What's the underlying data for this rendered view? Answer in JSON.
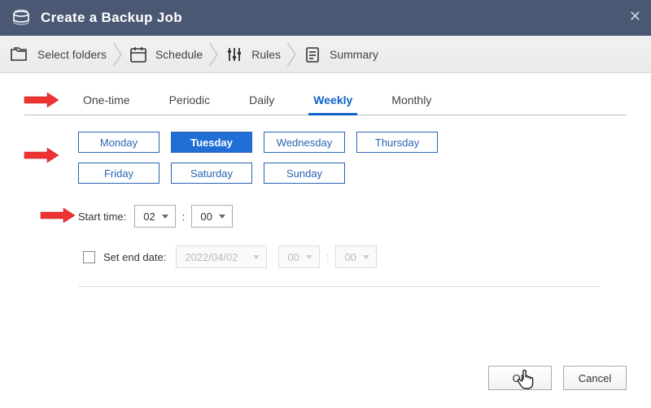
{
  "title": "Create a Backup Job",
  "steps": {
    "select_folders": "Select folders",
    "schedule": "Schedule",
    "rules": "Rules",
    "summary": "Summary"
  },
  "tabs": {
    "one_time": "One-time",
    "periodic": "Periodic",
    "daily": "Daily",
    "weekly": "Weekly",
    "monthly": "Monthly"
  },
  "active_tab": "weekly",
  "days": {
    "monday": "Monday",
    "tuesday": "Tuesday",
    "wednesday": "Wednesday",
    "thursday": "Thursday",
    "friday": "Friday",
    "saturday": "Saturday",
    "sunday": "Sunday"
  },
  "selected_day": "tuesday",
  "start_time": {
    "label": "Start time:",
    "hour": "02",
    "minute": "00"
  },
  "end_date": {
    "label": "Set end date:",
    "date": "2022/04/02",
    "hour": "00",
    "minute": "00",
    "enabled": false
  },
  "buttons": {
    "ok": "OK",
    "cancel": "Cancel"
  }
}
